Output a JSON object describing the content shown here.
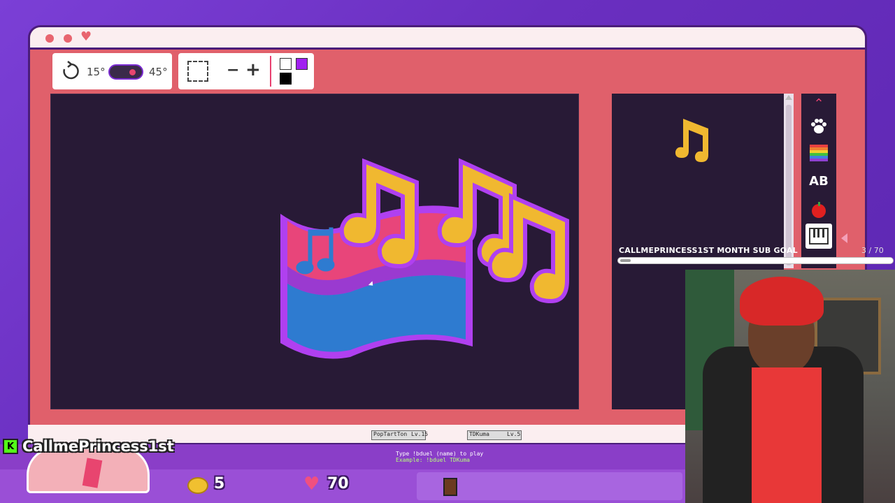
{
  "toolbar": {
    "rotate_small": "15°",
    "rotate_large": "45°",
    "zoom_out": "−",
    "zoom_in": "+"
  },
  "colors": {
    "primary": "#ffffff",
    "secondary": "#a020f0",
    "tertiary": "#000000",
    "window": "#e0606b",
    "canvas": "#281a36"
  },
  "categories": [
    "chevron-up-icon",
    "paw-icon",
    "rainbow-icon",
    "letters-icon",
    "apple-icon",
    "piano-icon"
  ],
  "sub_goal": {
    "title": "CALLMEPRINCESS1ST MONTH SUB GOAL",
    "count": "3 / 70",
    "progress": 0.04
  },
  "duel": {
    "player1": "PopTartTon",
    "player1_level": "Lv.15",
    "player2": "TDKuma",
    "player2_level": "Lv.5",
    "instruction": "Type !bduel (name) to play",
    "example": "Example: !bduel TDKuma"
  },
  "streamer": {
    "username": "CallmePrincess1st",
    "platform_icon": "K"
  },
  "stats": {
    "coins": "5",
    "hearts": "70"
  }
}
